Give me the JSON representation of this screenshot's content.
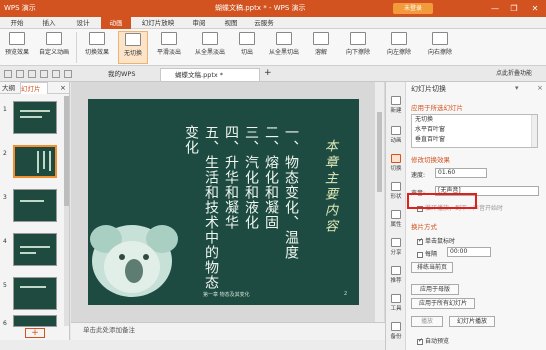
{
  "app": {
    "menu_label": "WPS 演示",
    "doc_title": "蝴蝶文稿.pptx * - WPS 演示",
    "login_label": "未登录"
  },
  "window_controls": [
    "—",
    "❐",
    "✕"
  ],
  "menu_tabs": [
    "开始",
    "插入",
    "设计",
    "动画",
    "幻灯片放映",
    "审阅",
    "视图",
    "云服务"
  ],
  "active_menu_tab": "动画",
  "ribbon": {
    "buttons": [
      "预览效果",
      "自定义动画",
      "切换效果",
      "无切换",
      "平滑淡出",
      "从全黑淡出",
      "切出",
      "从全黑切出",
      "溶解",
      "向下擦除",
      "向左擦除",
      "向右擦除"
    ],
    "selected": "无切换"
  },
  "doc_tabs": [
    {
      "label": "我的WPS"
    },
    {
      "label": "蝴蝶文稿.pptx *"
    }
  ],
  "doc_tab_plus": "+",
  "collapse_label": "点此折叠功能",
  "left_panel": {
    "tabs": [
      "大纲",
      "幻灯片"
    ],
    "close": "×",
    "slide_numbers": [
      "1",
      "2",
      "3",
      "4",
      "5",
      "6"
    ],
    "add_button": "+"
  },
  "slide": {
    "title": "本章主要内容",
    "columns": [
      "一、物态变化、温度",
      "二、熔化和凝固",
      "三、汽化和液化",
      "四、升华和凝华",
      "五、生活和技术中的物态",
      "变化"
    ],
    "footer": "第一章 物态及其变化",
    "page_no": "2"
  },
  "notes_placeholder": "单击此处添加备注",
  "task_pane": {
    "header": "幻灯片切换",
    "section_apply": "应用于所选幻灯片",
    "options": [
      "无切换",
      "水平百叶窗",
      "垂直百叶窗"
    ],
    "section_modify": "修改切换效果",
    "speed_label": "速度:",
    "speed_value": "01.60",
    "sound_label": "声音:",
    "sound_value": "[无声音]",
    "loop_label": "循环播放，到下一声音开始时",
    "section_advance": "换片方式",
    "on_click_label": "单击鼠标时",
    "every_label": "每隔",
    "every_value": "00:00",
    "sort_button": "排练当前页",
    "apply_master_button": "应用于母版",
    "apply_all_button": "应用于所有幻灯片",
    "play_button": "播放",
    "slideshow_button": "幻灯片播放",
    "autopreview_label": "自动预览"
  },
  "sidebar": [
    "新建",
    "动画",
    "切换",
    "形状",
    "属性",
    "分享",
    "推荐",
    "工具",
    "备份"
  ]
}
